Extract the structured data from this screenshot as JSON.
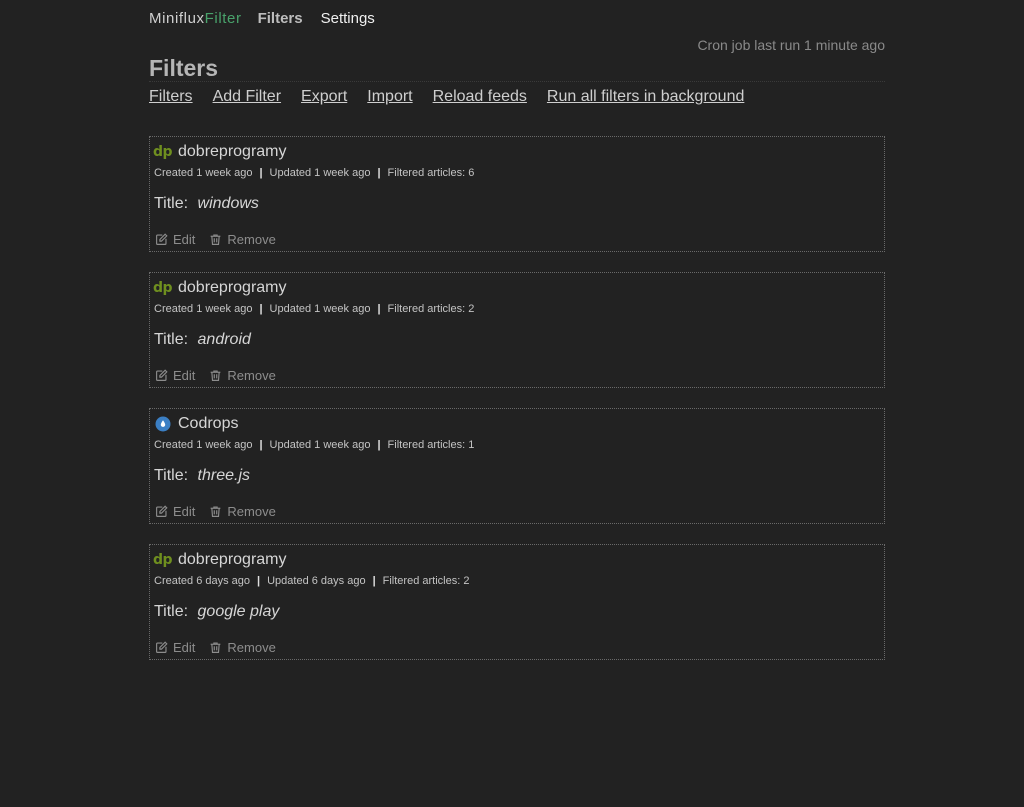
{
  "header": {
    "brand_main": "Miniflux",
    "brand_accent": "Filter",
    "nav": [
      {
        "label": "Filters"
      },
      {
        "label": "Settings"
      }
    ],
    "cron_status": "Cron job last run 1 minute ago"
  },
  "page": {
    "title": "Filters",
    "actions": [
      {
        "label": "Filters"
      },
      {
        "label": "Add Filter"
      },
      {
        "label": "Export"
      },
      {
        "label": "Import"
      },
      {
        "label": "Reload feeds"
      },
      {
        "label": "Run all filters in background"
      }
    ]
  },
  "filters": [
    {
      "icon": "dobreprogramy-icon",
      "icon_text": "dp",
      "feed": "dobreprogramy",
      "created": "Created 1 week ago",
      "updated": "Updated 1 week ago",
      "filtered": "Filtered articles: 6",
      "rule_label": "Title:",
      "rule_value": "windows",
      "edit": "Edit",
      "remove": "Remove"
    },
    {
      "icon": "dobreprogramy-icon",
      "icon_text": "dp",
      "feed": "dobreprogramy",
      "created": "Created 1 week ago",
      "updated": "Updated 1 week ago",
      "filtered": "Filtered articles: 2",
      "rule_label": "Title:",
      "rule_value": "android",
      "edit": "Edit",
      "remove": "Remove"
    },
    {
      "icon": "codrops-icon",
      "icon_text": "",
      "feed": "Codrops",
      "created": "Created 1 week ago",
      "updated": "Updated 1 week ago",
      "filtered": "Filtered articles: 1",
      "rule_label": "Title:",
      "rule_value": "three.js",
      "edit": "Edit",
      "remove": "Remove"
    },
    {
      "icon": "dobreprogramy-icon",
      "icon_text": "dp",
      "feed": "dobreprogramy",
      "created": "Created 6 days ago",
      "updated": "Updated 6 days ago",
      "filtered": "Filtered articles: 2",
      "rule_label": "Title:",
      "rule_value": "google play",
      "edit": "Edit",
      "remove": "Remove"
    }
  ],
  "colors": {
    "background": "#222222",
    "brand_accent": "#49a26b",
    "dp_icon": "#6f8f1f",
    "codrops_icon": "#3b7fc4"
  }
}
